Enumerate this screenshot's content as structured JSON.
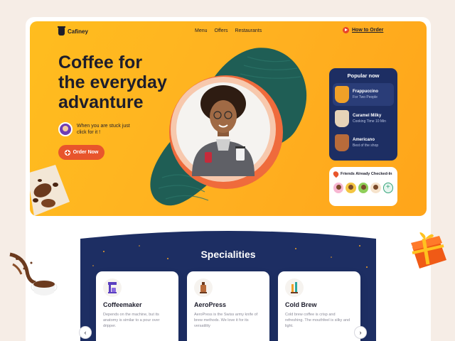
{
  "brand": {
    "name": "Cafiney"
  },
  "nav": {
    "items": [
      "Menu",
      "Offers",
      "Restaurants"
    ],
    "cta": "How to Order"
  },
  "hero": {
    "headline_line1": "Coffee for",
    "headline_line2": "the everyday",
    "headline_line3": "advanture",
    "stuck_text": "When you are stuck just click for it !",
    "order_button": "Order Now"
  },
  "popular": {
    "title": "Popular now",
    "items": [
      {
        "name": "Frappuccino",
        "sub": "For Two People",
        "color": "#f0a028"
      },
      {
        "name": "Caramel Milky",
        "sub": "Cooking Time 10 Min",
        "color": "#e8552c"
      },
      {
        "name": "Americano",
        "sub": "Best of the shop",
        "color": "#a0522d"
      }
    ]
  },
  "friends": {
    "title": "Friends Already Checked-In",
    "add": "+"
  },
  "specialities": {
    "title": "Specialities",
    "cards": [
      {
        "name": "Coffeemaker",
        "desc": "Depends on the machine, but its anatomy is similar to a pour over dripper."
      },
      {
        "name": "AeroPress",
        "desc": "AeroPress is the Swiss army knife of brew methods. We love it for its versatility"
      },
      {
        "name": "Cold Brew",
        "desc": "Cold brew coffee is crisp and refreshing. The mouthfeel is silky and light."
      }
    ],
    "prev": "‹",
    "next": "›"
  },
  "colors": {
    "accent": "#e8552c",
    "hero_bg": "#ffb020",
    "navy": "#1d2e63",
    "green": "#1f5e55"
  }
}
